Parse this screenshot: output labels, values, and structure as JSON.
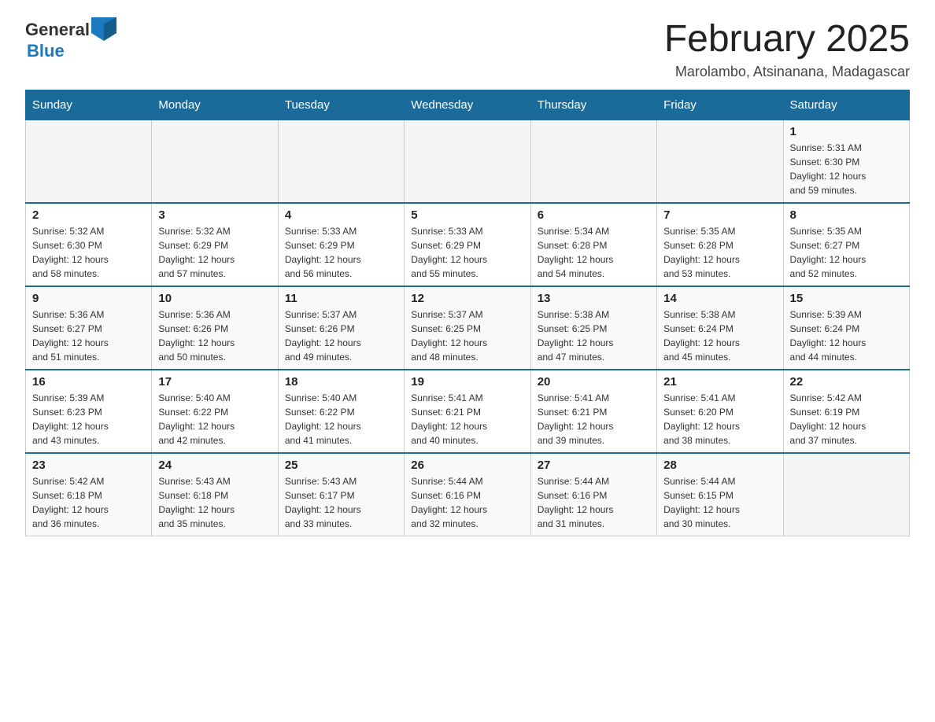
{
  "header": {
    "logo_general": "General",
    "logo_blue": "Blue",
    "month_title": "February 2025",
    "location": "Marolambo, Atsinanana, Madagascar"
  },
  "weekdays": [
    "Sunday",
    "Monday",
    "Tuesday",
    "Wednesday",
    "Thursday",
    "Friday",
    "Saturday"
  ],
  "weeks": [
    [
      {
        "day": "",
        "info": ""
      },
      {
        "day": "",
        "info": ""
      },
      {
        "day": "",
        "info": ""
      },
      {
        "day": "",
        "info": ""
      },
      {
        "day": "",
        "info": ""
      },
      {
        "day": "",
        "info": ""
      },
      {
        "day": "1",
        "info": "Sunrise: 5:31 AM\nSunset: 6:30 PM\nDaylight: 12 hours\nand 59 minutes."
      }
    ],
    [
      {
        "day": "2",
        "info": "Sunrise: 5:32 AM\nSunset: 6:30 PM\nDaylight: 12 hours\nand 58 minutes."
      },
      {
        "day": "3",
        "info": "Sunrise: 5:32 AM\nSunset: 6:29 PM\nDaylight: 12 hours\nand 57 minutes."
      },
      {
        "day": "4",
        "info": "Sunrise: 5:33 AM\nSunset: 6:29 PM\nDaylight: 12 hours\nand 56 minutes."
      },
      {
        "day": "5",
        "info": "Sunrise: 5:33 AM\nSunset: 6:29 PM\nDaylight: 12 hours\nand 55 minutes."
      },
      {
        "day": "6",
        "info": "Sunrise: 5:34 AM\nSunset: 6:28 PM\nDaylight: 12 hours\nand 54 minutes."
      },
      {
        "day": "7",
        "info": "Sunrise: 5:35 AM\nSunset: 6:28 PM\nDaylight: 12 hours\nand 53 minutes."
      },
      {
        "day": "8",
        "info": "Sunrise: 5:35 AM\nSunset: 6:27 PM\nDaylight: 12 hours\nand 52 minutes."
      }
    ],
    [
      {
        "day": "9",
        "info": "Sunrise: 5:36 AM\nSunset: 6:27 PM\nDaylight: 12 hours\nand 51 minutes."
      },
      {
        "day": "10",
        "info": "Sunrise: 5:36 AM\nSunset: 6:26 PM\nDaylight: 12 hours\nand 50 minutes."
      },
      {
        "day": "11",
        "info": "Sunrise: 5:37 AM\nSunset: 6:26 PM\nDaylight: 12 hours\nand 49 minutes."
      },
      {
        "day": "12",
        "info": "Sunrise: 5:37 AM\nSunset: 6:25 PM\nDaylight: 12 hours\nand 48 minutes."
      },
      {
        "day": "13",
        "info": "Sunrise: 5:38 AM\nSunset: 6:25 PM\nDaylight: 12 hours\nand 47 minutes."
      },
      {
        "day": "14",
        "info": "Sunrise: 5:38 AM\nSunset: 6:24 PM\nDaylight: 12 hours\nand 45 minutes."
      },
      {
        "day": "15",
        "info": "Sunrise: 5:39 AM\nSunset: 6:24 PM\nDaylight: 12 hours\nand 44 minutes."
      }
    ],
    [
      {
        "day": "16",
        "info": "Sunrise: 5:39 AM\nSunset: 6:23 PM\nDaylight: 12 hours\nand 43 minutes."
      },
      {
        "day": "17",
        "info": "Sunrise: 5:40 AM\nSunset: 6:22 PM\nDaylight: 12 hours\nand 42 minutes."
      },
      {
        "day": "18",
        "info": "Sunrise: 5:40 AM\nSunset: 6:22 PM\nDaylight: 12 hours\nand 41 minutes."
      },
      {
        "day": "19",
        "info": "Sunrise: 5:41 AM\nSunset: 6:21 PM\nDaylight: 12 hours\nand 40 minutes."
      },
      {
        "day": "20",
        "info": "Sunrise: 5:41 AM\nSunset: 6:21 PM\nDaylight: 12 hours\nand 39 minutes."
      },
      {
        "day": "21",
        "info": "Sunrise: 5:41 AM\nSunset: 6:20 PM\nDaylight: 12 hours\nand 38 minutes."
      },
      {
        "day": "22",
        "info": "Sunrise: 5:42 AM\nSunset: 6:19 PM\nDaylight: 12 hours\nand 37 minutes."
      }
    ],
    [
      {
        "day": "23",
        "info": "Sunrise: 5:42 AM\nSunset: 6:18 PM\nDaylight: 12 hours\nand 36 minutes."
      },
      {
        "day": "24",
        "info": "Sunrise: 5:43 AM\nSunset: 6:18 PM\nDaylight: 12 hours\nand 35 minutes."
      },
      {
        "day": "25",
        "info": "Sunrise: 5:43 AM\nSunset: 6:17 PM\nDaylight: 12 hours\nand 33 minutes."
      },
      {
        "day": "26",
        "info": "Sunrise: 5:44 AM\nSunset: 6:16 PM\nDaylight: 12 hours\nand 32 minutes."
      },
      {
        "day": "27",
        "info": "Sunrise: 5:44 AM\nSunset: 6:16 PM\nDaylight: 12 hours\nand 31 minutes."
      },
      {
        "day": "28",
        "info": "Sunrise: 5:44 AM\nSunset: 6:15 PM\nDaylight: 12 hours\nand 30 minutes."
      },
      {
        "day": "",
        "info": ""
      }
    ]
  ]
}
